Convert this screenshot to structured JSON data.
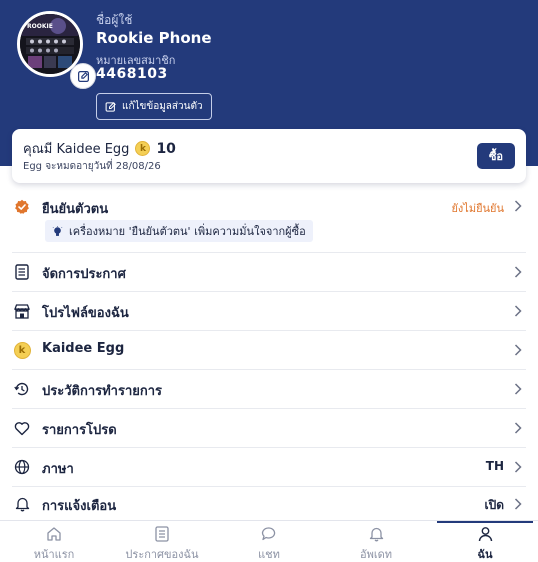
{
  "profile": {
    "username_label": "ชื่อผู้ใช้",
    "username": "Rookie Phone",
    "member_label": "หมายเลขสมาชิก",
    "member_number": "4468103",
    "edit_profile_label": "แก้ไขข้อมูลส่วนตัว",
    "avatar_caption": "ROOKIE"
  },
  "egg": {
    "prefix": "คุณมี Kaidee Egg",
    "coin_letter": "k",
    "count": "10",
    "expiry": "Egg จะหมดอายุวันที่ 28/08/26",
    "buy_label": "ซื้อ"
  },
  "menu": {
    "verify": {
      "label": "ยืนยันตัวตน",
      "status": "ยังไม่ยืนยัน",
      "banner": "เครื่องหมาย 'ยืนยันตัวตน' เพิ่มความมั่นใจจากผู้ซื้อ",
      "icon": "check-badge-icon"
    },
    "items": [
      {
        "label": "จัดการประกาศ",
        "icon": "list-doc-icon",
        "value": ""
      },
      {
        "label": "โปรไฟล์ของฉัน",
        "icon": "shop-icon",
        "value": ""
      },
      {
        "label": "Kaidee Egg",
        "icon": "egg-coin-icon",
        "value": ""
      },
      {
        "label": "ประวัติการทำรายการ",
        "icon": "history-icon",
        "value": ""
      },
      {
        "label": "รายการโปรด",
        "icon": "heart-icon",
        "value": ""
      },
      {
        "label": "ภาษา",
        "icon": "globe-icon",
        "value": "TH"
      },
      {
        "label": "การแจ้งเตือน",
        "icon": "bell-icon",
        "value": "เปิด"
      }
    ]
  },
  "tabs": [
    {
      "label": "หน้าแรก",
      "icon": "home-icon"
    },
    {
      "label": "ประกาศของฉัน",
      "icon": "listing-icon"
    },
    {
      "label": "แชท",
      "icon": "chat-icon"
    },
    {
      "label": "อัพเดท",
      "icon": "bell-icon"
    },
    {
      "label": "ฉัน",
      "icon": "person-icon"
    }
  ],
  "colors": {
    "brand_navy": "#233a7b",
    "warning_orange": "#e0762d",
    "coin_gold": "#f4cf55"
  }
}
